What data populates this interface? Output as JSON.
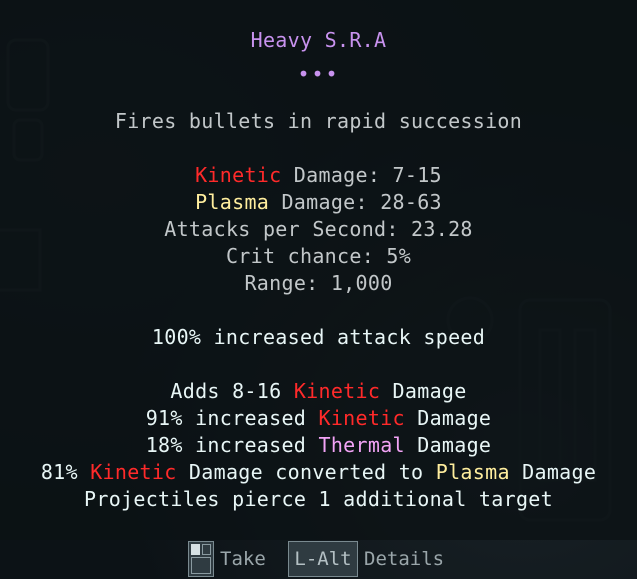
{
  "item": {
    "title": "Heavy S.R.A",
    "ellipsis": "•••",
    "description": "Fires bullets in rapid succession"
  },
  "stats": {
    "kinetic_label": "Kinetic",
    "kinetic_rest": " Damage: 7-15",
    "plasma_label": "Plasma",
    "plasma_rest": " Damage: 28-63",
    "attacks_per_second": "Attacks per Second: 23.28",
    "crit_chance": "Crit chance: 5%",
    "range": "Range: 1,000"
  },
  "implicit": {
    "attack_speed": "100% increased attack speed"
  },
  "modifiers": {
    "adds_prefix": "Adds 8-16 ",
    "adds_type": "Kinetic",
    "adds_suffix": " Damage",
    "inc_kin_prefix": "91% increased ",
    "inc_kin_type": "Kinetic",
    "inc_kin_suffix": " Damage",
    "inc_the_prefix": "18% increased ",
    "inc_the_type": "Thermal",
    "inc_the_suffix": " Damage",
    "conv_prefix": "81% ",
    "conv_type_from": "Kinetic",
    "conv_mid": " Damage converted to ",
    "conv_type_to": "Plasma",
    "conv_suffix": " Damage",
    "pierce": "Projectiles pierce 1 additional target"
  },
  "footer": {
    "take_label": "Take",
    "alt_key": "L-Alt",
    "details_label": "Details"
  },
  "colors": {
    "title": "#c892ee",
    "kinetic": "#ff2a2a",
    "plasma": "#ffee9e",
    "thermal": "#f2a3f6"
  },
  "icons": {
    "take_key": "mouse-left-button-icon"
  }
}
